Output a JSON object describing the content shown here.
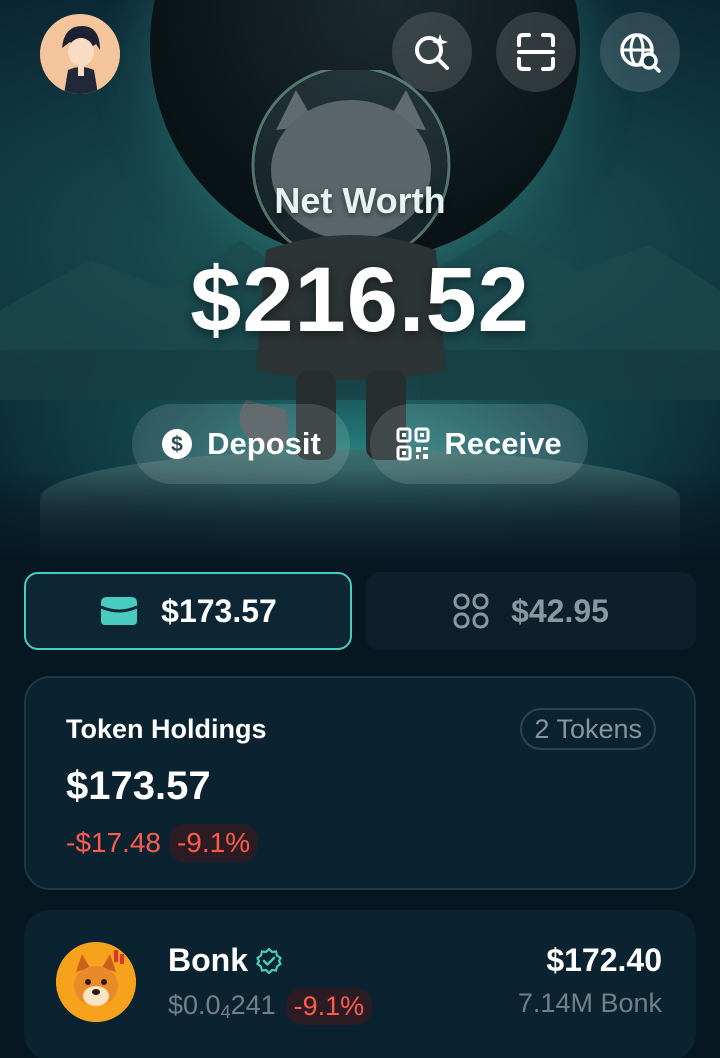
{
  "header": {
    "avatar_icon": "user-avatar-icon",
    "buttons": [
      {
        "icon": "search-sparkle-icon"
      },
      {
        "icon": "scan-icon"
      },
      {
        "icon": "globe-search-icon"
      }
    ]
  },
  "net_worth": {
    "label": "Net Worth",
    "value": "$216.52"
  },
  "actions": {
    "deposit": {
      "label": "Deposit",
      "icon": "dollar-circle-icon"
    },
    "receive": {
      "label": "Receive",
      "icon": "qr-code-icon"
    }
  },
  "tabs": [
    {
      "label": "$173.57",
      "icon": "wallet-icon",
      "active": true
    },
    {
      "label": "$42.95",
      "icon": "grid-icon",
      "active": false
    }
  ],
  "holdings": {
    "title": "Token Holdings",
    "count_badge": "2 Tokens",
    "value": "$173.57",
    "change": "-$17.48",
    "change_pct": "-9.1%"
  },
  "tokens": [
    {
      "name": "Bonk",
      "verified_icon": "verified-badge-icon",
      "price_prefix": "$0.0",
      "price_sub": "4",
      "price_suffix": "241",
      "change_pct": "-9.1%",
      "value": "$172.40",
      "amount": "7.14M Bonk"
    }
  ],
  "colors": {
    "accent": "#49cbc0",
    "negative": "#ff5a4e",
    "background": "#061722",
    "card": "#0b2230"
  }
}
